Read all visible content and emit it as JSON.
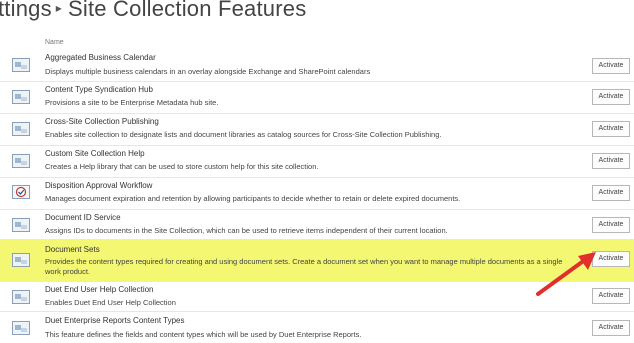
{
  "breadcrumb": {
    "parent": "ttings",
    "separator": "▸",
    "current": "Site Collection Features"
  },
  "table": {
    "column_name": "Name",
    "rows": [
      {
        "name": "Aggregated Business Calendar",
        "description": "Displays multiple business calendars in an overlay alongside Exchange and SharePoint calendars",
        "button": "Activate",
        "icon": "feature-icon"
      },
      {
        "name": "Content Type Syndication Hub",
        "description": "Provisions a site to be Enterprise Metadata hub site.",
        "button": "Activate",
        "icon": "feature-icon"
      },
      {
        "name": "Cross-Site Collection Publishing",
        "description": "Enables site collection to designate lists and document libraries as catalog sources for Cross-Site Collection Publishing.",
        "button": "Activate",
        "icon": "feature-icon"
      },
      {
        "name": "Custom Site Collection Help",
        "description": "Creates a Help library that can be used to store custom help for this site collection.",
        "button": "Activate",
        "icon": "feature-icon"
      },
      {
        "name": "Disposition Approval Workflow",
        "description": "Manages document expiration and retention by allowing participants to decide whether to retain or delete expired documents.",
        "button": "Activate",
        "icon": "workflow-icon"
      },
      {
        "name": "Document ID Service",
        "description": "Assigns IDs to documents in the Site Collection, which can be used to retrieve items independent of their current location.",
        "button": "Activate",
        "icon": "feature-icon"
      },
      {
        "name": "Document Sets",
        "description": "Provides the content types required for creating and using document sets. Create a document set when you want to manage multiple documents as a single work product.",
        "button": "Activate",
        "icon": "feature-icon",
        "highlighted": true
      },
      {
        "name": "Duet End User Help Collection",
        "description": "Enables Duet End User Help Collection",
        "button": "Activate",
        "icon": "feature-icon"
      },
      {
        "name": "Duet Enterprise Reports Content Types",
        "description": "This feature defines the fields and content types which will be used by Duet Enterprise Reports.",
        "button": "Activate",
        "icon": "feature-icon"
      }
    ]
  },
  "colors": {
    "highlight": "#f3f772",
    "arrow": "#e0302b",
    "text": "#333333"
  }
}
